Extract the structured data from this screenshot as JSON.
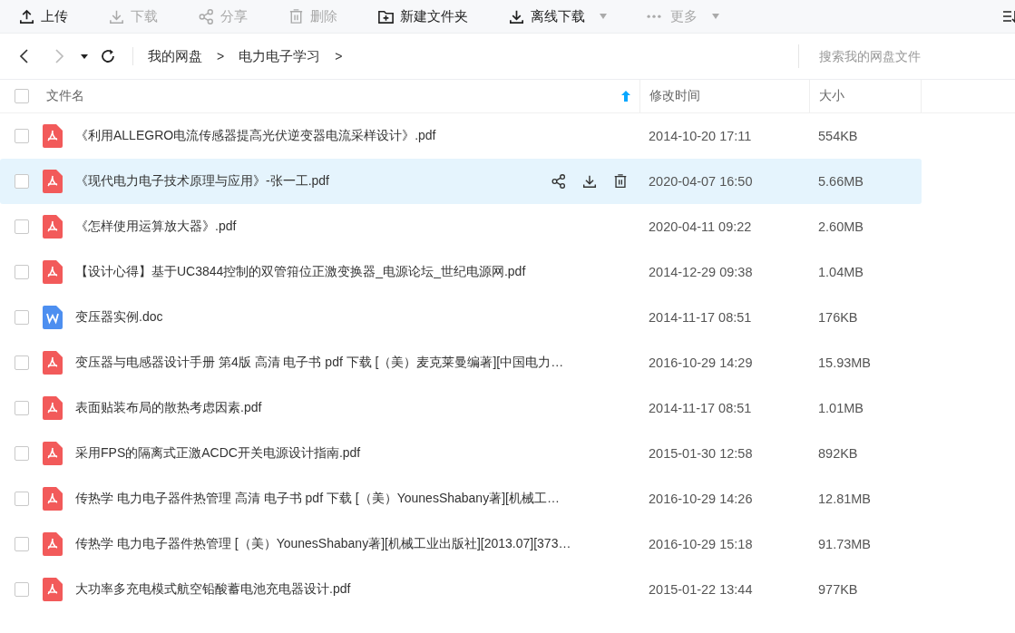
{
  "toolbar": [
    {
      "label": "上传",
      "disabled": false,
      "dropdown": false
    },
    {
      "label": "下载",
      "disabled": true,
      "dropdown": false
    },
    {
      "label": "分享",
      "disabled": true,
      "dropdown": false
    },
    {
      "label": "删除",
      "disabled": true,
      "dropdown": false
    },
    {
      "label": "新建文件夹",
      "disabled": false,
      "dropdown": false
    },
    {
      "label": "离线下载",
      "disabled": false,
      "dropdown": true
    },
    {
      "label": "更多",
      "disabled": true,
      "dropdown": true
    }
  ],
  "nav": {
    "back_disabled": false,
    "forward_disabled": true
  },
  "breadcrumb": [
    {
      "label": "我的网盘",
      "separator": ">"
    },
    {
      "label": "电力电子学习",
      "separator": ">"
    }
  ],
  "search": {
    "placeholder": "搜索我的网盘文件"
  },
  "table": {
    "columns": [
      {
        "label": "文件名",
        "sorted": true
      },
      {
        "label": "修改时间",
        "sorted": false
      },
      {
        "label": "大小",
        "sorted": false
      }
    ],
    "all_checked": false,
    "rows": [
      {
        "name": "《利用ALLEGRO电流传感器提高光伏逆变器电流采样设计》.pdf",
        "kind": "pdf",
        "modified": "2014-10-20 17:11",
        "size": "554KB",
        "checked": false,
        "highlighted": false
      },
      {
        "name": "《现代电力电子技术原理与应用》-张一工.pdf",
        "kind": "pdf",
        "modified": "2020-04-07 16:50",
        "size": "5.66MB",
        "checked": false,
        "highlighted": true
      },
      {
        "name": "《怎样使用运算放大器》.pdf",
        "kind": "pdf",
        "modified": "2020-04-11 09:22",
        "size": "2.60MB",
        "checked": false,
        "highlighted": false
      },
      {
        "name": "【设计心得】基于UC3844控制的双管箝位正激变换器_电源论坛_世纪电源网.pdf",
        "kind": "pdf",
        "modified": "2014-12-29 09:38",
        "size": "1.04MB",
        "checked": false,
        "highlighted": false
      },
      {
        "name": "变压器实例.doc",
        "kind": "doc",
        "modified": "2014-11-17 08:51",
        "size": "176KB",
        "checked": false,
        "highlighted": false
      },
      {
        "name": "变压器与电感器设计手册  第4版  高清 电子书 pdf 下载 [（美）麦克莱曼编著][中国电力…",
        "kind": "pdf",
        "modified": "2016-10-29 14:29",
        "size": "15.93MB",
        "checked": false,
        "highlighted": false
      },
      {
        "name": "表面贴装布局的散热考虑因素.pdf",
        "kind": "pdf",
        "modified": "2014-11-17 08:51",
        "size": "1.01MB",
        "checked": false,
        "highlighted": false
      },
      {
        "name": "采用FPS的隔离式正激ACDC开关电源设计指南.pdf",
        "kind": "pdf",
        "modified": "2015-01-30 12:58",
        "size": "892KB",
        "checked": false,
        "highlighted": false
      },
      {
        "name": "传热学  电力电子器件热管理  高清 电子书 pdf 下载 [（美）YounesShabany著][机械工…",
        "kind": "pdf",
        "modified": "2016-10-29 14:26",
        "size": "12.81MB",
        "checked": false,
        "highlighted": false
      },
      {
        "name": "传热学  电力电子器件热管理 [（美）YounesShabany著][机械工业出版社][2013.07][373…",
        "kind": "pdf",
        "modified": "2016-10-29 15:18",
        "size": "91.73MB",
        "checked": false,
        "highlighted": false
      },
      {
        "name": "大功率多充电模式航空铅酸蓄电池充电器设计.pdf",
        "kind": "pdf",
        "modified": "2015-01-22 13:44",
        "size": "977KB",
        "checked": false,
        "highlighted": false
      }
    ]
  }
}
